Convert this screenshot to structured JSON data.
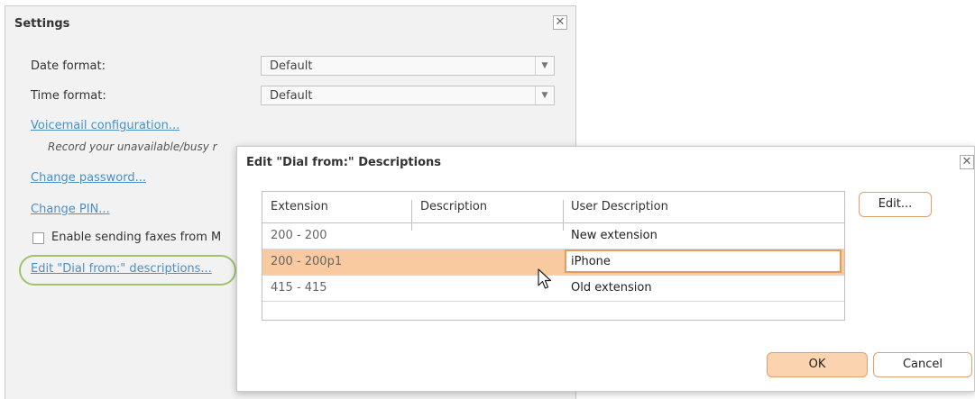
{
  "settings": {
    "title": "Settings",
    "close_glyph": "✕",
    "date_format_label": "Date format:",
    "date_format_value": "Default",
    "time_format_label": "Time format:",
    "time_format_value": "Default",
    "voicemail_link": "Voicemail configuration...",
    "voicemail_hint": "Record your unavailable/busy r",
    "change_password_link": "Change password...",
    "change_pin_link": "Change PIN...",
    "enable_fax_label": "Enable sending faxes from M",
    "edit_dial_from_link": "Edit \"Dial from:\" descriptions...",
    "highlight_color": "#9cc46a"
  },
  "dialog": {
    "title": "Edit \"Dial from:\" Descriptions",
    "close_glyph": "✕",
    "columns": [
      "Extension",
      "Description",
      "User Description"
    ],
    "rows": [
      {
        "extension": "200 - 200",
        "description": "",
        "user_description": "New extension"
      },
      {
        "extension": "200 - 200p1",
        "description": "",
        "user_description": "iPhone",
        "selected": true
      },
      {
        "extension": "415 - 415",
        "description": "",
        "user_description": "Old extension"
      }
    ],
    "edit_button": "Edit...",
    "ok_button": "OK",
    "cancel_button": "Cancel",
    "accent_color": "#e89a5a",
    "selection_color": "#f9c9a0"
  }
}
